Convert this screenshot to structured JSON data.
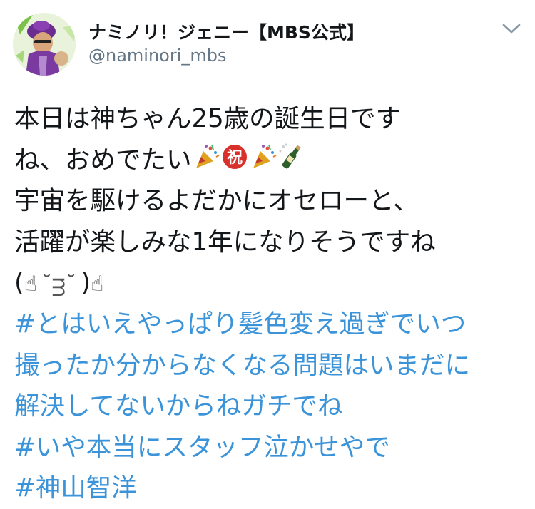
{
  "user": {
    "display_name": "ナミノリ！ジェニー【MBS公式】",
    "handle": "@naminori_mbs"
  },
  "tweet": {
    "line1": "本日は神ちゃん25歳の誕生日です",
    "line2_text": "ね、おめでたい",
    "line2_emojis": [
      "party-popper",
      "circled-ideograph-congratulation",
      "party-popper",
      "bottle-with-popping-cork"
    ],
    "line3": "宇宙を駆けるよだかにオセローと、",
    "line4": "活躍が楽しみな1年になりそうですね",
    "kaomoji": {
      "open": "(",
      "left_hand": "☝",
      "face": "˘ᴟ˘",
      "close": ")",
      "right_hand": "☝"
    },
    "hashtag1_line1": "#とはいえやっぱり髪色変え過ぎでいつ",
    "hashtag1_line2": "撮ったか分からなくなる問題はいまだに",
    "hashtag1_line3": "解決してないからねガチでね",
    "hashtag2": "#いや本当にスタッフ泣かせやで",
    "hashtag3": "#神山智洋"
  },
  "colors": {
    "text": "#14171a",
    "secondary": "#657786",
    "link": "#3b94d9"
  }
}
